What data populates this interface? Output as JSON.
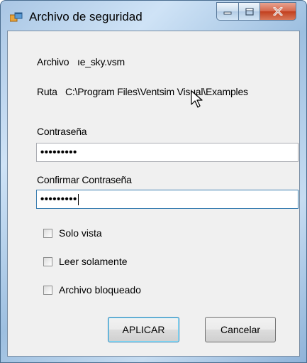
{
  "window": {
    "title": "Archivo de seguridad",
    "caption_buttons": [
      "minimize-icon",
      "maximize-icon",
      "close-icon"
    ]
  },
  "file": {
    "label": "Archivo",
    "name": "ıe_sky.vsm"
  },
  "path": {
    "label": "Ruta",
    "value": "C:\\Program Files\\Ventsim Visual\\Examples"
  },
  "password": {
    "label": "Contraseña",
    "masked_value": "•••••••••"
  },
  "confirm_password": {
    "label": "Confirmar Contraseña",
    "masked_value": "•••••••••"
  },
  "options": [
    {
      "label": "Solo vista",
      "checked": false
    },
    {
      "label": "Leer solamente",
      "checked": false
    },
    {
      "label": "Archivo bloqueado",
      "checked": false
    }
  ],
  "buttons": {
    "apply": "APLICAR",
    "cancel": "Cancelar"
  },
  "colors": {
    "accent": "#3c7fb1",
    "frame": "#a9c6e4",
    "client": "#f0f0f0",
    "close_button": "#c13f1e"
  }
}
